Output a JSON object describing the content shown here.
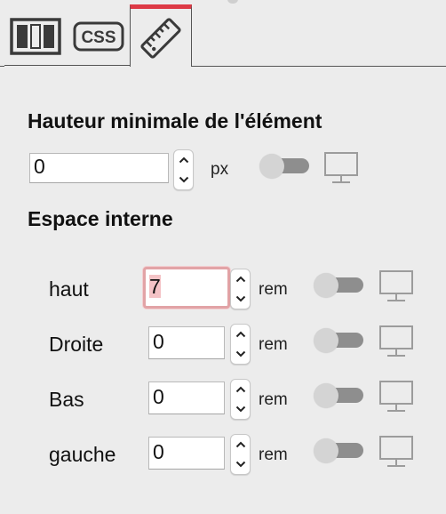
{
  "tabs": [
    {
      "name": "layout",
      "icon": "layout-panel-icon"
    },
    {
      "name": "css",
      "icon": "css-badge-icon",
      "label": "CSS"
    },
    {
      "name": "dimensions",
      "icon": "ruler-icon",
      "active": true
    }
  ],
  "accent_color": "#dd3a46",
  "min_height": {
    "title": "Hauteur minimale de l'élément",
    "value": "0",
    "unit": "px",
    "responsive_toggle_on": false,
    "device_icon": "desktop-icon"
  },
  "padding": {
    "title": "Espace interne",
    "rows": [
      {
        "label": "haut",
        "value": "7",
        "unit": "rem",
        "focused": true,
        "toggle_on": false,
        "device_icon": "desktop-icon"
      },
      {
        "label": "Droite",
        "value": "0",
        "unit": "rem",
        "focused": false,
        "toggle_on": false,
        "device_icon": "desktop-icon"
      },
      {
        "label": "Bas",
        "value": "0",
        "unit": "rem",
        "focused": false,
        "toggle_on": false,
        "device_icon": "desktop-icon"
      },
      {
        "label": "gauche",
        "value": "0",
        "unit": "rem",
        "focused": false,
        "toggle_on": false,
        "device_icon": "desktop-icon"
      }
    ]
  }
}
